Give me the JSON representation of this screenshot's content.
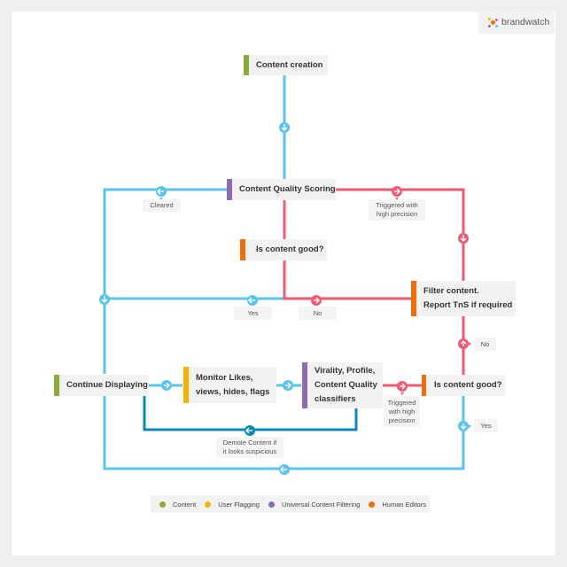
{
  "brand": {
    "name": "brandwatch"
  },
  "colors": {
    "content": "#8aab3a",
    "user_flagging": "#f5b400",
    "universal_filtering": "#8c6bb1",
    "human_editors": "#ee6f0a",
    "flow_blue": "#5bc3eb",
    "flow_red": "#ee5a72",
    "flow_darkblue": "#0a88b8"
  },
  "nodes": {
    "content_creation": "Content creation",
    "content_quality_scoring": "Content Quality Scoring",
    "is_content_good_1": "Is content good?",
    "filter_content_line1": "Filter content.",
    "filter_content_line2": "Report TnS if required",
    "continue_displaying": "Continue Displaying",
    "monitor_line1": "Monitor Likes,",
    "monitor_line2": "views, hides, flags",
    "classifiers_line1": "Virality, Profile,",
    "classifiers_line2": "Content Quality",
    "classifiers_line3": "classifiers",
    "is_content_good_2": "Is content good?"
  },
  "edge_labels": {
    "cleared": "Cleared",
    "triggered_high_precision_1_line1": "Triggered with",
    "triggered_high_precision_1_line2": "high precision",
    "yes_1": "Yes",
    "no_1": "No",
    "no_2": "No",
    "triggered_high_precision_2_line1": "Triggered",
    "triggered_high_precision_2_line2": "with high",
    "triggered_high_precision_2_line3": "precision",
    "yes_2": "Yes",
    "demote_line1": "Demote Content if",
    "demote_line2": "it looks suspicious"
  },
  "legend": [
    {
      "label": "Content",
      "color": "#8aab3a"
    },
    {
      "label": "User Flagging",
      "color": "#f5b400"
    },
    {
      "label": "Universal Content Filtering",
      "color": "#8c6bb1"
    },
    {
      "label": "Human Editors",
      "color": "#ee6f0a"
    }
  ]
}
